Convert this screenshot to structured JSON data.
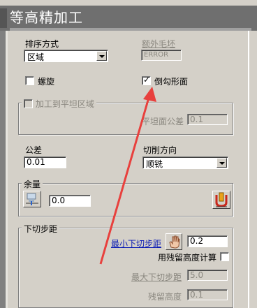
{
  "title": "等高精加工",
  "sort": {
    "label": "排序方式",
    "value": "区域"
  },
  "extra_stock": {
    "label": "额外毛坯",
    "value": "ERROR"
  },
  "spiral": {
    "label": "螺旋",
    "checked": false
  },
  "undercut": {
    "label": "倒勾形面",
    "checked": true
  },
  "flat_area": {
    "label": "加工到平坦区域",
    "checked": false,
    "tolerance_label": "平坦面公差",
    "tolerance_value": "0.1"
  },
  "tolerance": {
    "label": "公差",
    "value": "0.01"
  },
  "cut_direction": {
    "label": "切削方向",
    "value": "顺铣"
  },
  "allowance": {
    "label": "余量",
    "value": "0.0"
  },
  "stepdown": {
    "label": "下切步距",
    "min_label": "最小下切步距",
    "min_value": "0.2",
    "residual_label": "用残留高度计算",
    "residual_checked": false,
    "max_label": "最大下切步距",
    "max_value": "5.0",
    "cusp_label": "残留高度",
    "cusp_value": "0.1"
  },
  "colors": {
    "panel": "#d4d0c8",
    "title_bar": "#6f6f6f",
    "arrow": "#e8403d",
    "link": "#0a1bb5"
  },
  "icons": {
    "allowance_left": "thickness-icon",
    "allowance_right": "component-thickness-icon",
    "stepdown": "hand-pointer-icon"
  }
}
